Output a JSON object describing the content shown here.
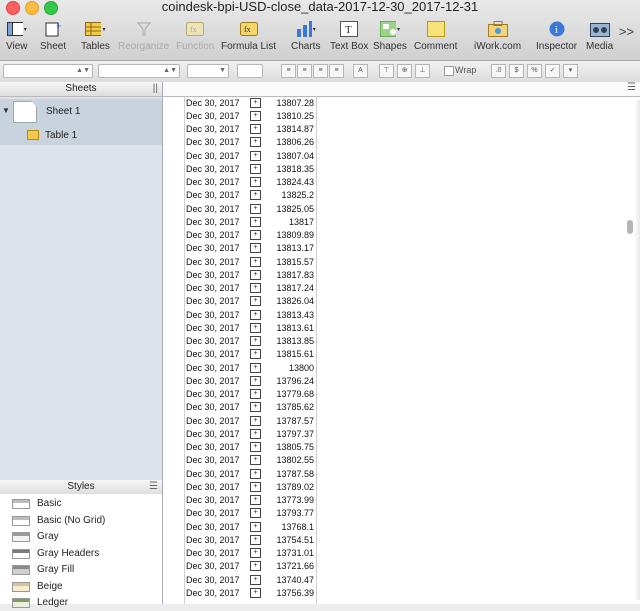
{
  "window": {
    "title": "coindesk-bpi-USD-close_data-2017-12-30_2017-12-31"
  },
  "toolbar": [
    {
      "id": "view",
      "label": "View",
      "icon": "view-icon",
      "enabled": true
    },
    {
      "id": "sheet",
      "label": "Sheet",
      "icon": "sheet-icon",
      "enabled": true
    },
    {
      "id": "tables",
      "label": "Tables",
      "icon": "tables-icon",
      "enabled": true
    },
    {
      "id": "reorganize",
      "label": "Reorganize",
      "icon": "reorganize-icon",
      "enabled": false
    },
    {
      "id": "function",
      "label": "Function",
      "icon": "function-icon",
      "enabled": false
    },
    {
      "id": "formula-list",
      "label": "Formula List",
      "icon": "formula-list-icon",
      "enabled": true
    },
    {
      "id": "charts",
      "label": "Charts",
      "icon": "charts-icon",
      "enabled": true
    },
    {
      "id": "text-box",
      "label": "Text Box",
      "icon": "text-box-icon",
      "enabled": true
    },
    {
      "id": "shapes",
      "label": "Shapes",
      "icon": "shapes-icon",
      "enabled": true
    },
    {
      "id": "comment",
      "label": "Comment",
      "icon": "comment-icon",
      "enabled": true
    },
    {
      "id": "iwork",
      "label": "iWork.com",
      "icon": "iwork-icon",
      "enabled": true
    },
    {
      "id": "inspector",
      "label": "Inspector",
      "icon": "inspector-icon",
      "enabled": true
    },
    {
      "id": "media",
      "label": "Media",
      "icon": "media-icon",
      "enabled": true
    }
  ],
  "toolbar_more": ">>",
  "formatbar": {
    "wrap_label": "Wrap"
  },
  "sheets_panel": {
    "header": "Sheets",
    "sheet_label": "Sheet 1",
    "table_label": "Table 1"
  },
  "styles_panel": {
    "header": "Styles",
    "items": [
      {
        "label": "Basic",
        "swatch": "#ffffff",
        "stripe": "#bdbdbd"
      },
      {
        "label": "Basic (No Grid)",
        "swatch": "#ffffff",
        "stripe": "#bdbdbd"
      },
      {
        "label": "Gray",
        "swatch": "#f3f3f3",
        "stripe": "#9c9c9c"
      },
      {
        "label": "Gray Headers",
        "swatch": "#ffffff",
        "stripe": "#7a7a7a"
      },
      {
        "label": "Gray Fill",
        "swatch": "#d0d0d0",
        "stripe": "#8a8a8a"
      },
      {
        "label": "Beige",
        "swatch": "#f6ecd0",
        "stripe": "#d5c59a"
      },
      {
        "label": "Ledger",
        "swatch": "#e8f0e0",
        "stripe": "#7a9f5a"
      }
    ]
  },
  "table": {
    "rows": [
      {
        "date": "Dec 30, 2017",
        "value": "13807.28"
      },
      {
        "date": "Dec 30, 2017",
        "value": "13810.25"
      },
      {
        "date": "Dec 30, 2017",
        "value": "13814.87"
      },
      {
        "date": "Dec 30, 2017",
        "value": "13806.26"
      },
      {
        "date": "Dec 30, 2017",
        "value": "13807.04"
      },
      {
        "date": "Dec 30, 2017",
        "value": "13818.35"
      },
      {
        "date": "Dec 30, 2017",
        "value": "13824.43"
      },
      {
        "date": "Dec 30, 2017",
        "value": "13825.2"
      },
      {
        "date": "Dec 30, 2017",
        "value": "13825.05"
      },
      {
        "date": "Dec 30, 2017",
        "value": "13817"
      },
      {
        "date": "Dec 30, 2017",
        "value": "13809.89"
      },
      {
        "date": "Dec 30, 2017",
        "value": "13813.17"
      },
      {
        "date": "Dec 30, 2017",
        "value": "13815.57"
      },
      {
        "date": "Dec 30, 2017",
        "value": "13817.83"
      },
      {
        "date": "Dec 30, 2017",
        "value": "13817.24"
      },
      {
        "date": "Dec 30, 2017",
        "value": "13826.04"
      },
      {
        "date": "Dec 30, 2017",
        "value": "13813.43"
      },
      {
        "date": "Dec 30, 2017",
        "value": "13813.61"
      },
      {
        "date": "Dec 30, 2017",
        "value": "13813.85"
      },
      {
        "date": "Dec 30, 2017",
        "value": "13815.61"
      },
      {
        "date": "Dec 30, 2017",
        "value": "13800"
      },
      {
        "date": "Dec 30, 2017",
        "value": "13796.24"
      },
      {
        "date": "Dec 30, 2017",
        "value": "13779.68"
      },
      {
        "date": "Dec 30, 2017",
        "value": "13785.62"
      },
      {
        "date": "Dec 30, 2017",
        "value": "13787.57"
      },
      {
        "date": "Dec 30, 2017",
        "value": "13797.37"
      },
      {
        "date": "Dec 30, 2017",
        "value": "13805.75"
      },
      {
        "date": "Dec 30, 2017",
        "value": "13802.55"
      },
      {
        "date": "Dec 30, 2017",
        "value": "13787.58"
      },
      {
        "date": "Dec 30, 2017",
        "value": "13789.02"
      },
      {
        "date": "Dec 30, 2017",
        "value": "13773.99"
      },
      {
        "date": "Dec 30, 2017",
        "value": "13793.77"
      },
      {
        "date": "Dec 30, 2017",
        "value": "13768.1"
      },
      {
        "date": "Dec 30, 2017",
        "value": "13754.51"
      },
      {
        "date": "Dec 30, 2017",
        "value": "13731.01"
      },
      {
        "date": "Dec 30, 2017",
        "value": "13721.66"
      },
      {
        "date": "Dec 30, 2017",
        "value": "13740.47"
      },
      {
        "date": "Dec 30, 2017",
        "value": "13756.39"
      }
    ]
  }
}
